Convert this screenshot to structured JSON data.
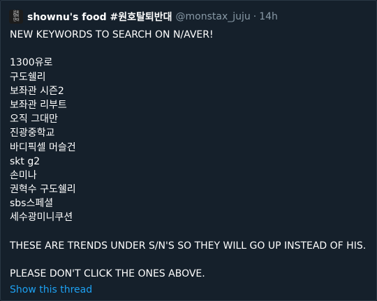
{
  "tweet": {
    "avatar_text": [
      "원호",
      "탈퇴",
      "반대"
    ],
    "display_name": "shownu's food #원호탈퇴반대",
    "handle": "@monstax_juju",
    "separator": "·",
    "time": "14h",
    "lines": [
      "NEW KEYWORDS TO SEARCH ON N/AVER!",
      "",
      "1300유로",
      "구도쉘리",
      "보좌관 시즌2",
      "보좌관 리부트",
      "오직 그대만",
      "진광중학교",
      "바디픽셀 머슬건",
      "skt g2",
      "손미나",
      "권혁수 구도쉘리",
      "sbs스페셜",
      "세수광미니쿠션",
      "",
      "THESE ARE TRENDS UNDER S/N'S SO THEY WILL GO UP INSTEAD OF HIS.",
      "",
      "PLEASE DON'T CLICK THE ONES ABOVE."
    ],
    "show_thread": "Show this thread"
  },
  "colors": {
    "background": "#15202b",
    "text": "#ffffff",
    "secondary_text": "#8899a6",
    "link": "#1da1f2"
  }
}
